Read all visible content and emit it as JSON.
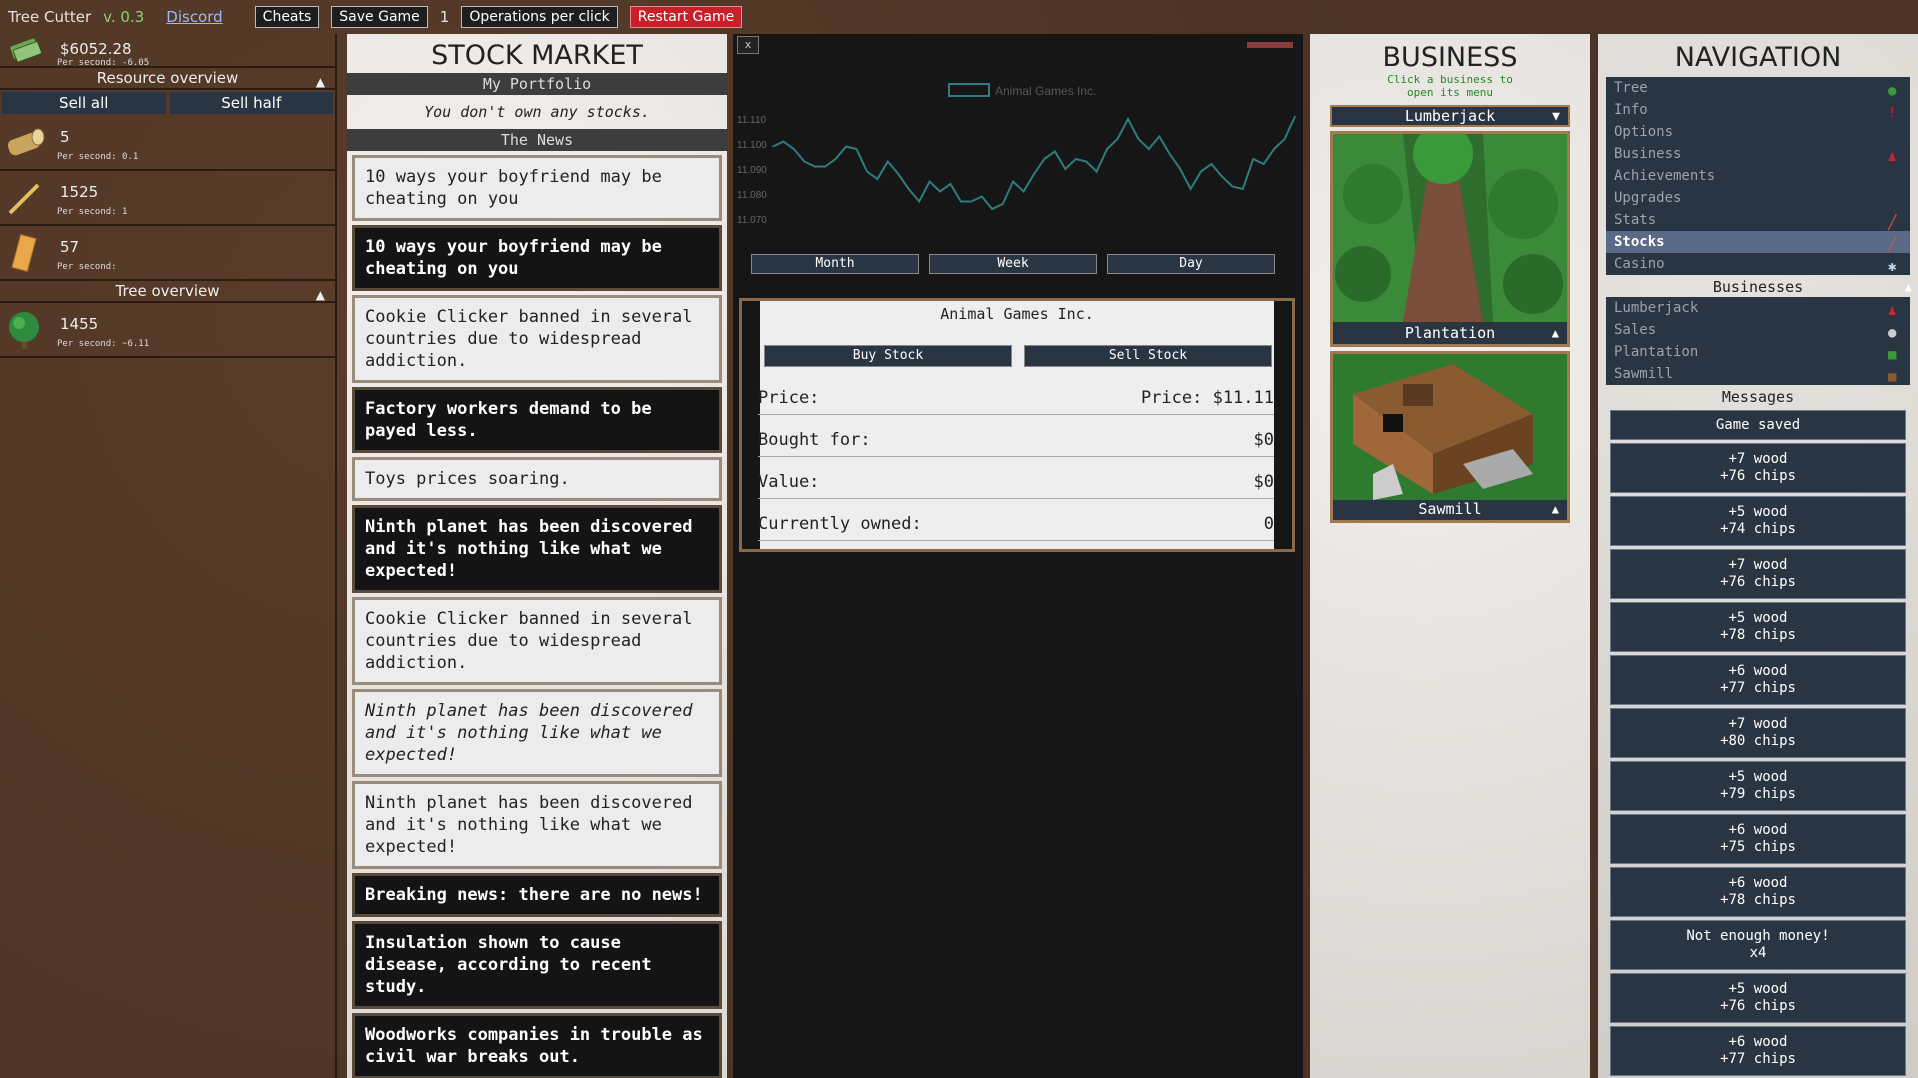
{
  "topbar": {
    "title": "Tree Cutter",
    "version": "v. 0.3",
    "discord": "Discord",
    "cheats": "Cheats",
    "save": "Save Game",
    "operations_count": "1",
    "operations": "Operations per click",
    "restart": "Restart Game"
  },
  "resources": {
    "money": {
      "amount": "$6052.28",
      "per_second": "Per second: -6.05"
    },
    "resource_overview": "Resource overview",
    "sell_all": "Sell all",
    "sell_half": "Sell half",
    "wood": {
      "amount": "5",
      "per_second": "Per second: 0.1"
    },
    "chips": {
      "amount": "1525",
      "per_second": "Per second: 1"
    },
    "plank": {
      "amount": "57",
      "per_second": "Per second:"
    },
    "tree_overview": "Tree overview",
    "trees": {
      "amount": "1455",
      "per_second": "Per second: ~6.11"
    }
  },
  "stock_market": {
    "title": "STOCK MARKET",
    "portfolio_head": "My Portfolio",
    "portfolio_msg": "You don't own any stocks.",
    "news_head": "The News",
    "news": [
      {
        "text": "10 ways your boyfriend may be cheating on you",
        "style": "light"
      },
      {
        "text": "10 ways your boyfriend may be cheating on you",
        "style": "dark"
      },
      {
        "text": "Cookie Clicker banned in several countries due to widespread addiction.",
        "style": "light"
      },
      {
        "text": "Factory workers demand to be payed less.",
        "style": "dark"
      },
      {
        "text": "Toys prices soaring.",
        "style": "light"
      },
      {
        "text": "Ninth planet has been discovered and it's nothing like what we expected!",
        "style": "dark"
      },
      {
        "text": "Cookie Clicker banned in several countries due to widespread addiction.",
        "style": "light"
      },
      {
        "text": "Ninth planet has been discovered and it's nothing like what we expected!",
        "style": "italic"
      },
      {
        "text": "Ninth planet has been discovered and it's nothing like what we expected!",
        "style": "light"
      },
      {
        "text": "Breaking news: there are no news!",
        "style": "dark"
      },
      {
        "text": "Insulation shown to cause disease, according to recent study.",
        "style": "dark"
      },
      {
        "text": "Woodworks companies in trouble as civil war breaks out.",
        "style": "dark"
      }
    ]
  },
  "chart": {
    "close": "x",
    "month": "Month",
    "week": "Week",
    "day": "Day"
  },
  "chart_data": {
    "type": "line",
    "series": [
      {
        "name": "Animal Games Inc.",
        "color": "#2e7d7d",
        "values": [
          11.099,
          11.101,
          11.098,
          11.093,
          11.091,
          11.091,
          11.094,
          11.099,
          11.098,
          11.089,
          11.086,
          11.093,
          11.088,
          11.082,
          11.077,
          11.085,
          11.081,
          11.084,
          11.077,
          11.077,
          11.079,
          11.074,
          11.076,
          11.085,
          11.081,
          11.088,
          11.094,
          11.097,
          11.09,
          11.094,
          11.093,
          11.089,
          11.098,
          11.102,
          11.11,
          11.102,
          11.098,
          11.103,
          11.096,
          11.09,
          11.082,
          11.089,
          11.092,
          11.087,
          11.083,
          11.082,
          11.094,
          11.092,
          11.098,
          11.102,
          11.111
        ]
      }
    ],
    "yticks": [
      "11.110",
      "11.100",
      "11.090",
      "11.080",
      "11.070"
    ],
    "ylim": [
      11.066,
      11.114
    ],
    "grid": false,
    "legend": "top-center"
  },
  "stock_detail": {
    "company": "Animal Games Inc.",
    "buy": "Buy Stock",
    "sell": "Sell Stock",
    "price_label": "Price:",
    "price_value": "Price: $11.11",
    "bought_label": "Bought for:",
    "bought_value": "$0",
    "value_label": "Value:",
    "value_value": "$0",
    "owned_label": "Currently owned:",
    "owned_value": "0"
  },
  "business": {
    "title": "BUSINESS",
    "hint1": "Click a business to",
    "hint2": "open its menu",
    "selected": "Lumberjack",
    "cards": [
      {
        "name": "Plantation"
      },
      {
        "name": "Sawmill"
      }
    ]
  },
  "navigation": {
    "title": "NAVIGATION",
    "items": [
      {
        "label": "Tree"
      },
      {
        "label": "Info"
      },
      {
        "label": "Options"
      },
      {
        "label": "Business"
      },
      {
        "label": "Achievements"
      },
      {
        "label": "Upgrades"
      },
      {
        "label": "Stats"
      },
      {
        "label": "Stocks"
      },
      {
        "label": "Casino"
      }
    ],
    "businesses_head": "Businesses",
    "businesses": [
      {
        "label": "Lumberjack"
      },
      {
        "label": "Sales"
      },
      {
        "label": "Plantation"
      },
      {
        "label": "Sawmill"
      }
    ],
    "messages_head": "Messages",
    "messages": [
      [
        "Game saved"
      ],
      [
        "+7 wood",
        "+76 chips"
      ],
      [
        "+5 wood",
        "+74 chips"
      ],
      [
        "+7 wood",
        "+76 chips"
      ],
      [
        "+5 wood",
        "+78 chips"
      ],
      [
        "+6 wood",
        "+77 chips"
      ],
      [
        "+7 wood",
        "+80 chips"
      ],
      [
        "+5 wood",
        "+79 chips"
      ],
      [
        "+6 wood",
        "+75 chips"
      ],
      [
        "+6 wood",
        "+78 chips"
      ],
      [
        "Not enough money!",
        "x4"
      ],
      [
        "+5 wood",
        "+76 chips"
      ],
      [
        "+6 wood",
        "+77 chips"
      ]
    ]
  },
  "colors": {
    "accent_red": "#c8202a",
    "button_bg": "#2a3544",
    "version_green": "#8fd16f"
  }
}
